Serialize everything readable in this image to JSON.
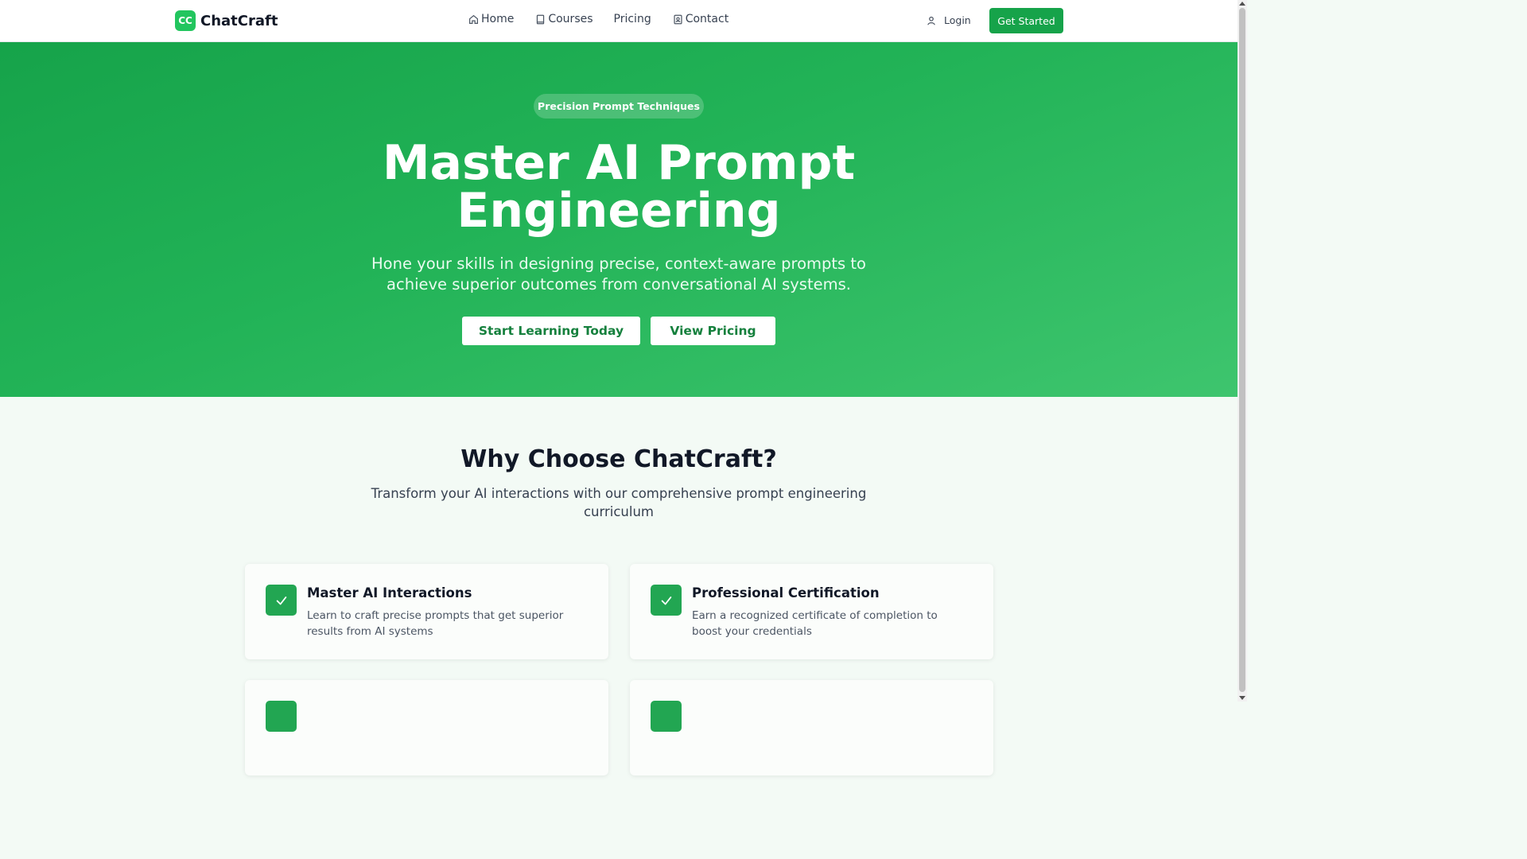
{
  "header": {
    "logo_badge": "CC",
    "logo_text": "ChatCraft",
    "nav": [
      {
        "label": "Home",
        "icon": "home-icon"
      },
      {
        "label": "Courses",
        "icon": "book-icon"
      },
      {
        "label": "Pricing",
        "icon": ""
      },
      {
        "label": "Contact",
        "icon": "contact-icon"
      }
    ],
    "login_label": "Login",
    "get_started_label": "Get Started"
  },
  "hero": {
    "badge": "Precision Prompt Techniques",
    "title_line1": "Master AI Prompt",
    "title_line2": "Engineering",
    "subtitle": "Hone your skills in designing precise, context-aware prompts to achieve superior outcomes from conversational AI systems.",
    "primary_cta": "Start Learning Today",
    "secondary_cta": "View Pricing"
  },
  "features": {
    "title": "Why Choose ChatCraft?",
    "subtitle": "Transform your AI interactions with our comprehensive prompt engineering curriculum",
    "cards": [
      {
        "title": "Master AI Interactions",
        "description": "Learn to craft precise prompts that get superior results from AI systems",
        "icon": "check-icon"
      },
      {
        "title": "Professional Certification",
        "description": "Earn a recognized certificate of completion to boost your credentials",
        "icon": "check-icon"
      }
    ]
  },
  "colors": {
    "brand": "#22c55e",
    "button_green": "#16a34a",
    "hero_gradient_start": "#16a34a",
    "hero_gradient_end": "#3ec56e"
  }
}
